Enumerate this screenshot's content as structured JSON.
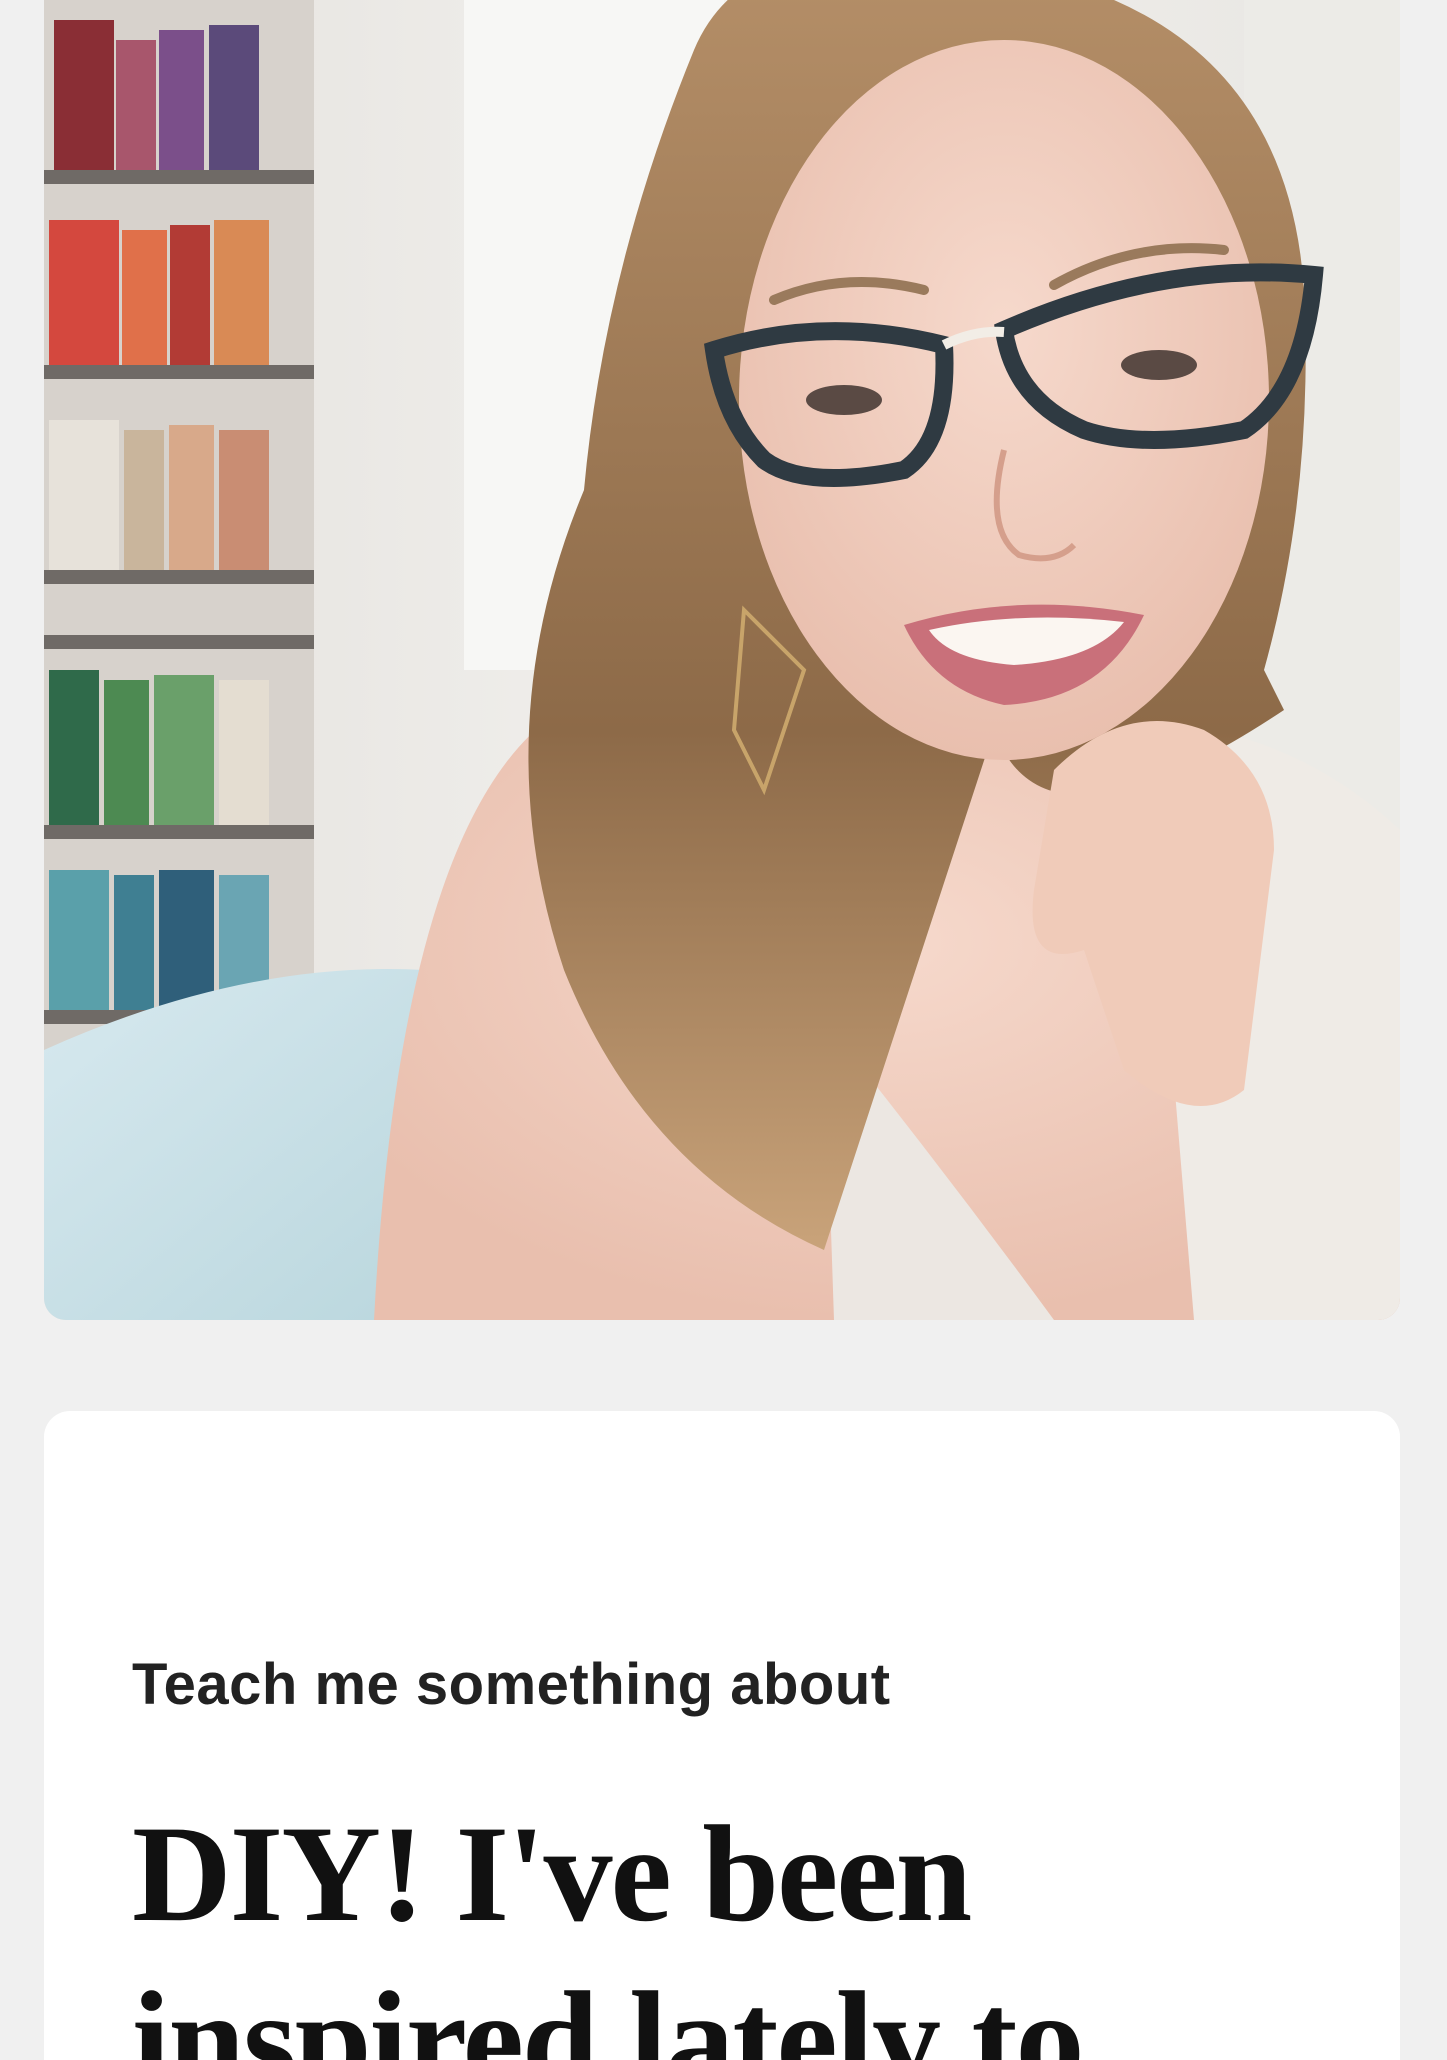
{
  "profile": {
    "photo": {
      "alt": "",
      "icon": "profile-photo"
    },
    "prompt": {
      "question": "Teach me something about",
      "answer": "DIY! I've been inspired lately to"
    }
  },
  "colors": {
    "page_background": "#f0f0f0",
    "card_background": "#ffffff",
    "label_text": "#222222",
    "answer_text": "#111111"
  }
}
